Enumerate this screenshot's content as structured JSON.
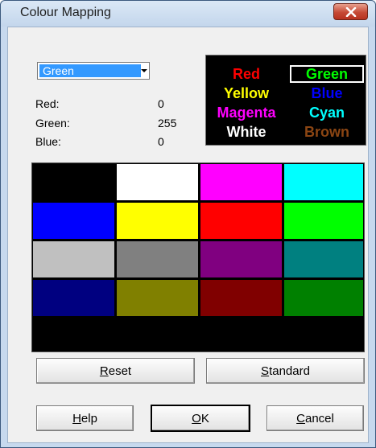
{
  "window": {
    "title": "Colour Mapping",
    "close_glyph": "✕"
  },
  "selector": {
    "value": "Green",
    "arrow_icon": "dropdown-arrow-icon"
  },
  "rgb": {
    "red_label": "Red:",
    "red_value": "0",
    "green_label": "Green:",
    "green_value": "255",
    "blue_label": "Blue:",
    "blue_value": "0"
  },
  "preview": {
    "items": [
      {
        "label": "Red",
        "color": "#ff0000"
      },
      {
        "label": "Green",
        "color": "#00ff00"
      },
      {
        "label": "Yellow",
        "color": "#ffff00"
      },
      {
        "label": "Blue",
        "color": "#0000ff"
      },
      {
        "label": "Magenta",
        "color": "#ff00ff"
      },
      {
        "label": "Cyan",
        "color": "#00ffff"
      },
      {
        "label": "White",
        "color": "#ffffff"
      },
      {
        "label": "Brown",
        "color": "#8b4513"
      }
    ],
    "selected": "Green"
  },
  "palette": {
    "rows": [
      [
        "#000000",
        "#ffffff",
        "#ff00ff",
        "#00ffff"
      ],
      [
        "#0000ff",
        "#ffff00",
        "#ff0000",
        "#00ff00"
      ],
      [
        "#c0c0c0",
        "#808080",
        "#800080",
        "#008080"
      ],
      [
        "#000080",
        "#808000",
        "#800000",
        "#008000"
      ]
    ]
  },
  "buttons": {
    "reset": {
      "mnemonic": "R",
      "rest": "eset"
    },
    "standard": {
      "mnemonic": "S",
      "rest": "tandard"
    },
    "help": {
      "mnemonic": "H",
      "rest": "elp"
    },
    "ok": {
      "mnemonic": "O",
      "rest": "K"
    },
    "cancel": {
      "mnemonic": "C",
      "rest": "ancel"
    }
  }
}
